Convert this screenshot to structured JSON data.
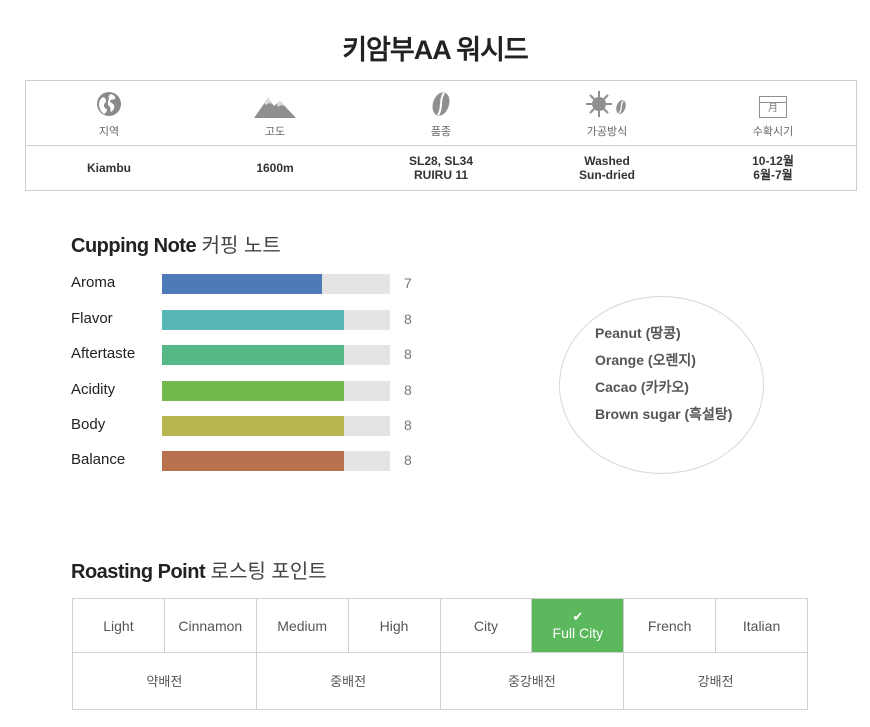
{
  "title": "키암부AA 워시드",
  "info": {
    "headers": [
      {
        "label": "지역",
        "icon": "globe-icon"
      },
      {
        "label": "고도",
        "icon": "mountain-icon"
      },
      {
        "label": "품종",
        "icon": "coffee-bean-icon"
      },
      {
        "label": "가공방식",
        "icon": "sun-bean-icon"
      },
      {
        "label": "수확시기",
        "icon": "calendar-icon"
      }
    ],
    "calendar_glyph": "月",
    "values": [
      {
        "line1": "Kiambu",
        "line2": ""
      },
      {
        "line1": "1600m",
        "line2": ""
      },
      {
        "line1": "SL28, SL34",
        "line2": "RUIRU 11"
      },
      {
        "line1": "Washed",
        "line2": "Sun-dried"
      },
      {
        "line1": "10-12월",
        "line2": "6월-7월"
      }
    ]
  },
  "cupping": {
    "title": "Cupping Note",
    "subtitle": "커핑 노트",
    "max": 10,
    "items": [
      {
        "name": "Aroma",
        "value": 7,
        "color": "#4f79b9"
      },
      {
        "name": "Flavor",
        "value": 8,
        "color": "#56b7b5"
      },
      {
        "name": "Aftertaste",
        "value": 8,
        "color": "#55b887"
      },
      {
        "name": "Acidity",
        "value": 8,
        "color": "#73b94e"
      },
      {
        "name": "Body",
        "value": 8,
        "color": "#b7b650"
      },
      {
        "name": "Balance",
        "value": 8,
        "color": "#b9714e"
      }
    ],
    "notes": [
      "Peanut (땅콩)",
      "Orange (오렌지)",
      "Cacao (카카오)",
      "Brown sugar (흑설탕)"
    ]
  },
  "roasting": {
    "title": "Roasting Point",
    "subtitle": "로스팅 포인트",
    "levels": [
      "Light",
      "Cinnamon",
      "Medium",
      "High",
      "City",
      "Full City",
      "French",
      "Italian"
    ],
    "selected": "Full City",
    "check": "✔",
    "groups": [
      "약배전",
      "중배전",
      "중강배전",
      "강배전"
    ],
    "accent": "#5cb85c"
  }
}
